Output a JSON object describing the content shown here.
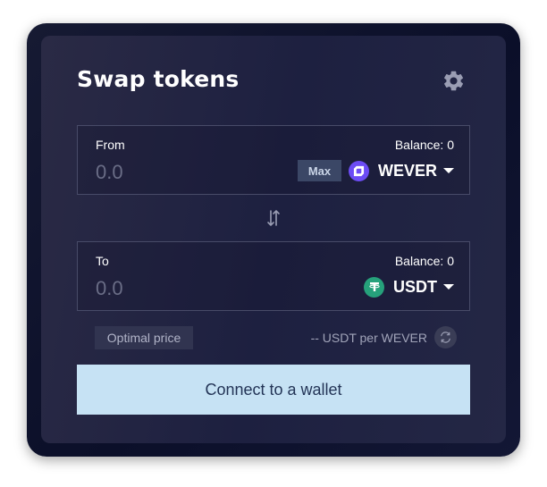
{
  "header": {
    "title": "Swap tokens",
    "settings_icon": "gear-icon"
  },
  "from": {
    "label": "From",
    "balance": "Balance: 0",
    "amount_placeholder": "0.0",
    "max_label": "Max",
    "token": {
      "name": "WEVER",
      "icon": "wever-token-icon",
      "color": "#6c4cf5"
    }
  },
  "switch_icon": "swap-arrows-icon",
  "to": {
    "label": "To",
    "balance": "Balance: 0",
    "amount_placeholder": "0.0",
    "token": {
      "name": "USDT",
      "icon": "usdt-token-icon",
      "color": "#26a17b"
    }
  },
  "price": {
    "badge": "Optimal price",
    "rate": "-- USDT per WEVER",
    "rate_toggle_icon": "refresh-icon"
  },
  "connect_label": "Connect to a wallet",
  "colors": {
    "background": "#0b0f29",
    "card": "#1d2040",
    "button": "#c6e2f4",
    "button_text": "#233456",
    "max_button": "#3b4766"
  }
}
